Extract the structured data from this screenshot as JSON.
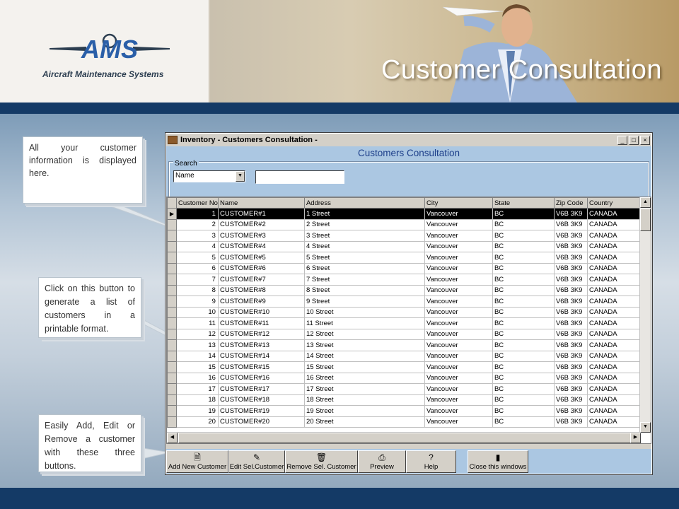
{
  "slide": {
    "title": "Customer Consultation",
    "logo_text": "AMS",
    "logo_subtitle": "Aircraft Maintenance Systems"
  },
  "callouts": [
    "All your customer information is displayed here.",
    "Click on this button to generate a list of customers in a printable format.",
    "Easily Add, Edit or Remove a customer with these three buttons."
  ],
  "window": {
    "title": "Inventory - Customers Consultation -",
    "form_title": "Customers Consultation",
    "search_label": "Search",
    "search_field_value": "Name",
    "search_input_value": ""
  },
  "grid": {
    "columns": [
      "Customer No",
      "Name",
      "Address",
      "City",
      "State",
      "Zip Code",
      "Country"
    ],
    "rows": [
      [
        "1",
        "CUSTOMER#1",
        "1 Street",
        "Vancouver",
        "BC",
        "V6B 3K9",
        "CANADA"
      ],
      [
        "2",
        "CUSTOMER#2",
        "2 Street",
        "Vancouver",
        "BC",
        "V6B 3K9",
        "CANADA"
      ],
      [
        "3",
        "CUSTOMER#3",
        "3 Street",
        "Vancouver",
        "BC",
        "V6B 3K9",
        "CANADA"
      ],
      [
        "4",
        "CUSTOMER#4",
        "4 Street",
        "Vancouver",
        "BC",
        "V6B 3K9",
        "CANADA"
      ],
      [
        "5",
        "CUSTOMER#5",
        "5 Street",
        "Vancouver",
        "BC",
        "V6B 3K9",
        "CANADA"
      ],
      [
        "6",
        "CUSTOMER#6",
        "6 Street",
        "Vancouver",
        "BC",
        "V6B 3K9",
        "CANADA"
      ],
      [
        "7",
        "CUSTOMER#7",
        "7 Street",
        "Vancouver",
        "BC",
        "V6B 3K9",
        "CANADA"
      ],
      [
        "8",
        "CUSTOMER#8",
        "8 Street",
        "Vancouver",
        "BC",
        "V6B 3K9",
        "CANADA"
      ],
      [
        "9",
        "CUSTOMER#9",
        "9 Street",
        "Vancouver",
        "BC",
        "V6B 3K9",
        "CANADA"
      ],
      [
        "10",
        "CUSTOMER#10",
        "10 Street",
        "Vancouver",
        "BC",
        "V6B 3K9",
        "CANADA"
      ],
      [
        "11",
        "CUSTOMER#11",
        "11 Street",
        "Vancouver",
        "BC",
        "V6B 3K9",
        "CANADA"
      ],
      [
        "12",
        "CUSTOMER#12",
        "12 Street",
        "Vancouver",
        "BC",
        "V6B 3K9",
        "CANADA"
      ],
      [
        "13",
        "CUSTOMER#13",
        "13 Street",
        "Vancouver",
        "BC",
        "V6B 3K9",
        "CANADA"
      ],
      [
        "14",
        "CUSTOMER#14",
        "14 Street",
        "Vancouver",
        "BC",
        "V6B 3K9",
        "CANADA"
      ],
      [
        "15",
        "CUSTOMER#15",
        "15 Street",
        "Vancouver",
        "BC",
        "V6B 3K9",
        "CANADA"
      ],
      [
        "16",
        "CUSTOMER#16",
        "16 Street",
        "Vancouver",
        "BC",
        "V6B 3K9",
        "CANADA"
      ],
      [
        "17",
        "CUSTOMER#17",
        "17 Street",
        "Vancouver",
        "BC",
        "V6B 3K9",
        "CANADA"
      ],
      [
        "18",
        "CUSTOMER#18",
        "18 Street",
        "Vancouver",
        "BC",
        "V6B 3K9",
        "CANADA"
      ],
      [
        "19",
        "CUSTOMER#19",
        "19 Street",
        "Vancouver",
        "BC",
        "V6B 3K9",
        "CANADA"
      ],
      [
        "20",
        "CUSTOMER#20",
        "20 Street",
        "Vancouver",
        "BC",
        "V6B 3K9",
        "CANADA"
      ]
    ],
    "selected_row": 0
  },
  "toolbar": [
    {
      "name": "add-new-customer-button",
      "icon": "add-document-icon",
      "label": "Add New Customer"
    },
    {
      "name": "edit-customer-button",
      "icon": "pencil-icon",
      "label": "Edit Sel.Customer"
    },
    {
      "name": "remove-customer-button",
      "icon": "trash-icon",
      "label": "Remove Sel. Customer"
    },
    {
      "name": "preview-button",
      "icon": "printer-icon",
      "label": "Preview"
    },
    {
      "name": "help-button",
      "icon": "help-icon",
      "label": "Help"
    },
    {
      "name": "close-window-button",
      "icon": "exit-door-icon",
      "label": "Close this windows"
    }
  ],
  "colors": {
    "dark_band": "#143a66",
    "form_background": "#abc7e2",
    "form_title": "#1d3f8a",
    "selected_row": "#000000"
  }
}
